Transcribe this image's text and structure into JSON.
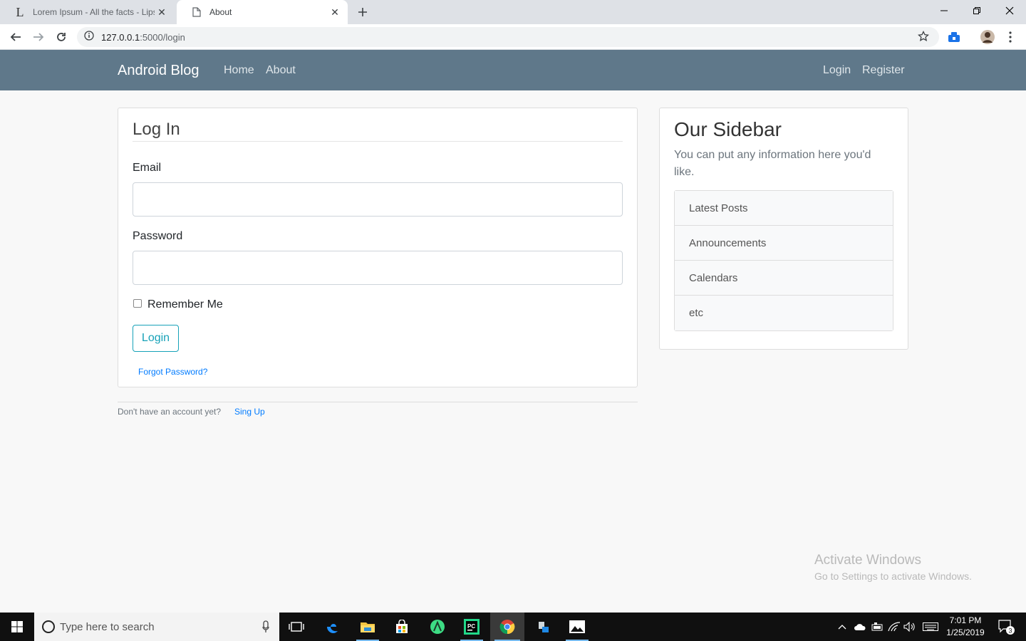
{
  "browser": {
    "tabs": [
      {
        "title": "Lorem Ipsum - All the facts - Lipsum",
        "favicon_letter": "L"
      },
      {
        "title": "About"
      }
    ],
    "url_host": "127.0.0.1",
    "url_path": ":5000/login"
  },
  "navbar": {
    "brand": "Android Blog",
    "links": [
      "Home",
      "About"
    ],
    "right_links": [
      "Login",
      "Register"
    ]
  },
  "login_form": {
    "legend": "Log In",
    "email_label": "Email",
    "password_label": "Password",
    "remember_label": "Remember Me",
    "submit": "Login",
    "forgot": "Forgot Password?"
  },
  "footer": {
    "text": "Don't have an account yet?",
    "link": "Sing Up"
  },
  "sidebar": {
    "title": "Our Sidebar",
    "text": "You can put any information here you'd like.",
    "items": [
      "Latest Posts",
      "Announcements",
      "Calendars",
      "etc"
    ]
  },
  "watermark": {
    "line1": "Activate Windows",
    "line2": "Go to Settings to activate Windows."
  },
  "taskbar": {
    "search_placeholder": "Type here to search",
    "time": "7:01 PM",
    "date": "1/25/2019",
    "notification_count": "3"
  },
  "colors": {
    "navbar": "#5f788a",
    "accent": "#17a2b8",
    "link": "#007bff"
  }
}
